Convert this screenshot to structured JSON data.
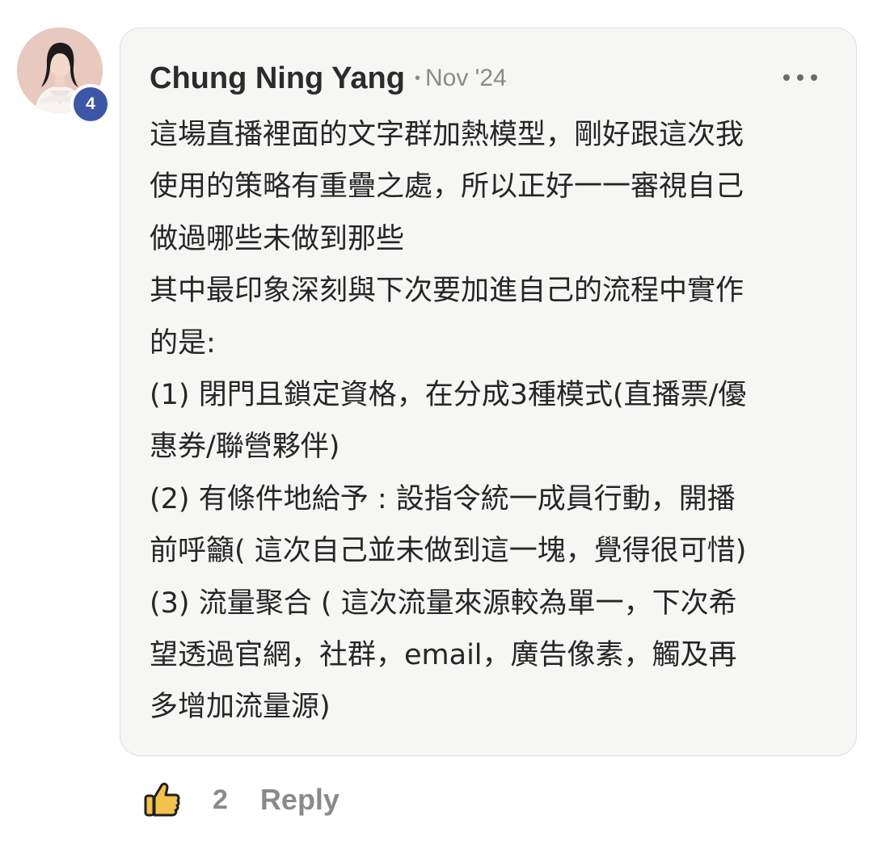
{
  "post": {
    "author": "Chung Ning Yang",
    "separator": "•",
    "date": "Nov '24",
    "trust_level": "4",
    "body_lines": [
      "這場直播裡面的文字群加熱模型，剛好跟這次我",
      "使用的策略有重疊之處，所以正好一一審視自己",
      "做過哪些未做到那些",
      "其中最印象深刻與下次要加進自己的流程中實作",
      "的是:",
      "(1) 閉門且鎖定資格，在分成3種模式(直播票/優",
      "惠券/聯營夥伴)",
      "(2) 有條件地給予 : 設指令統一成員行動，開播",
      "前呼籲( 這次自己並未做到這一塊，覺得很可惜)",
      "(3) 流量聚合 ( 這次流量來源較為單一，下次希",
      "望透過官網，社群，email，廣告像素，觸及再",
      "多增加流量源)"
    ]
  },
  "actions": {
    "like_icon": "thumbs-up-icon",
    "like_count": "2",
    "reply_label": "Reply"
  },
  "icons": {
    "more": "more-horizontal-icon"
  },
  "colors": {
    "badge": "#3e56a8",
    "bubble_bg": "#f6f6f5",
    "muted_text": "#8a8a8a",
    "body_text": "#262626",
    "thumb_fill": "#f2c14e"
  }
}
